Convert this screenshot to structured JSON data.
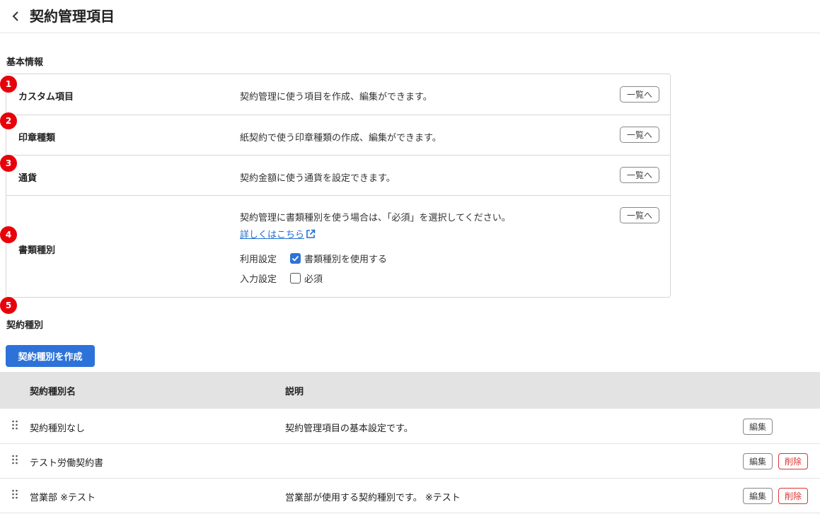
{
  "header": {
    "title": "契約管理項目",
    "back_icon": "chevron-left-icon"
  },
  "basic_info": {
    "section_title": "基本情報",
    "rows": [
      {
        "badge": "1",
        "label": "カスタム項目",
        "description": "契約管理に使う項目を作成、編集ができます。",
        "button": "一覧へ"
      },
      {
        "badge": "2",
        "label": "印章種類",
        "description": "紙契約で使う印章種類の作成、編集ができます。",
        "button": "一覧へ"
      },
      {
        "badge": "3",
        "label": "通貨",
        "description": "契約金額に使う通貨を設定できます。",
        "button": "一覧へ"
      },
      {
        "badge": "4",
        "label": "書類種別",
        "description": "契約管理に書類種別を使う場合は、「必須」を選択してください。",
        "button": "一覧へ",
        "link_text": "詳しくはこちら",
        "usage_label": "利用設定",
        "usage_option": "書類種別を使用する",
        "usage_checked": true,
        "input_label": "入力設定",
        "input_option": "必須",
        "input_checked": false
      }
    ]
  },
  "contract_types": {
    "badge": "5",
    "section_title": "契約種別",
    "create_button": "契約種別を作成",
    "columns": {
      "name": "契約種別名",
      "description": "説明"
    },
    "rows": [
      {
        "name": "契約種別なし",
        "description": "契約管理項目の基本設定です。",
        "edit": "編集",
        "delete": ""
      },
      {
        "name": "テスト労働契約書",
        "description": "",
        "edit": "編集",
        "delete": "削除"
      },
      {
        "name": "営業部 ※テスト",
        "description": "営業部が使用する契約種別です。 ※テスト",
        "edit": "編集",
        "delete": "削除"
      }
    ]
  },
  "colors": {
    "accent": "#2d72d9",
    "badge": "#e8000b",
    "danger": "#dd3333",
    "table_header": "#e3e3e3"
  }
}
